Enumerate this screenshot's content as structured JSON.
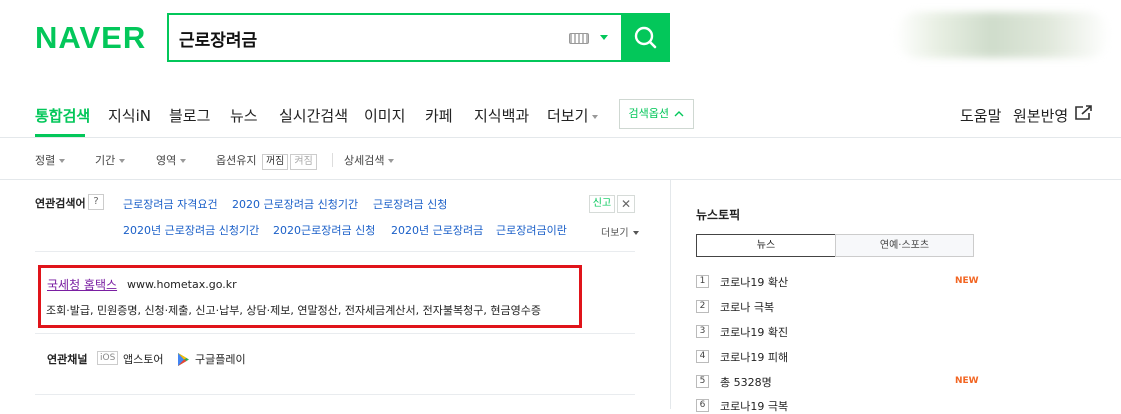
{
  "header": {
    "logo": "NAVER",
    "query": "근로장려금"
  },
  "nav": {
    "items": [
      "통합검색",
      "지식iN",
      "블로그",
      "뉴스",
      "실시간검색",
      "이미지",
      "카페",
      "지식백과",
      "더보기"
    ],
    "search_options": "검색옵션",
    "help": "도움말",
    "original_reflect": "원본반영"
  },
  "filters": {
    "sort": "정렬",
    "period": "기간",
    "area": "영역",
    "keep_option": "옵션유지",
    "off": "꺼짐",
    "on": "켜짐",
    "detail": "상세검색"
  },
  "related": {
    "title": "연관검색어",
    "help": "?",
    "row1": [
      "근로장려금 자격요건",
      "2020 근로장려금 신청기간",
      "근로장려금 신청"
    ],
    "row2": [
      "2020년 근로장려금 신청기간",
      "2020근로장려금 신청",
      "2020년 근로장려금",
      "근로장려금이란"
    ],
    "report": "신고",
    "more": "더보기"
  },
  "site_result": {
    "name": "국세청 홈택스",
    "url": "www.hometax.go.kr",
    "desc": "조회·발급, 민원증명, 신청·제출, 신고·납부, 상담·제보, 연말정산, 전자세금계산서, 전자불복청구, 현금영수증"
  },
  "channels": {
    "title": "연관채널",
    "ios": "iOS",
    "appstore": "앱스토어",
    "googleplay": "구글플레이"
  },
  "news_topic": {
    "title": "뉴스토픽",
    "tabs": [
      "뉴스",
      "연예·스포츠"
    ],
    "items": [
      {
        "rank": "1",
        "text": "코로나19 확산",
        "badge": "NEW"
      },
      {
        "rank": "2",
        "text": "코로나 극복",
        "badge": ""
      },
      {
        "rank": "3",
        "text": "코로나19 확진",
        "badge": ""
      },
      {
        "rank": "4",
        "text": "코로나19 피해",
        "badge": ""
      },
      {
        "rank": "5",
        "text": "총 5328명",
        "badge": "NEW"
      },
      {
        "rank": "6",
        "text": "코로나19 극복",
        "badge": ""
      }
    ]
  },
  "colors": {
    "brand": "#03c75a",
    "link": "#1a5fc8",
    "highlight_box": "#e0141a",
    "new_badge": "#f26522"
  }
}
